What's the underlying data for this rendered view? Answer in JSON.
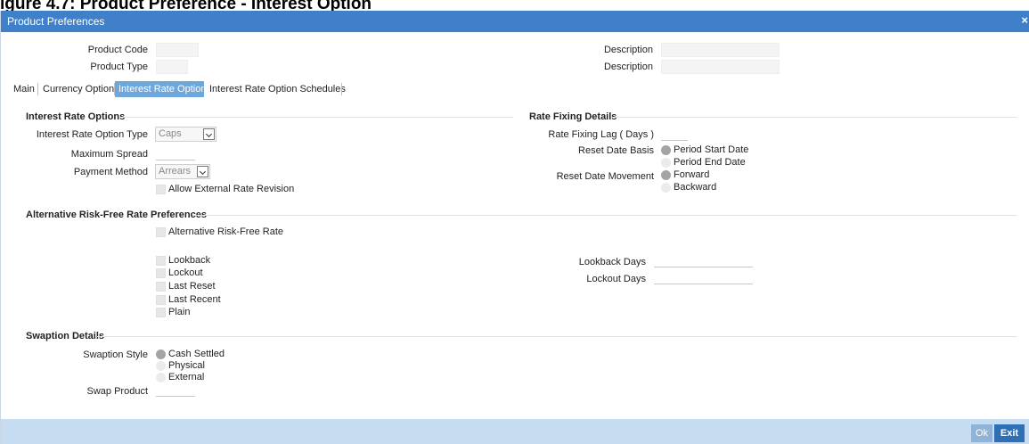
{
  "caption": "igure 4.7: Product Preference - Interest Option",
  "window": {
    "title": "Product Preferences",
    "close_glyph": "×"
  },
  "header": {
    "product_code_label": "Product Code",
    "product_type_label": "Product Type",
    "description_label_1": "Description",
    "description_label_2": "Description",
    "product_code_value": "",
    "product_type_value": "",
    "description_value_1": "",
    "description_value_2": ""
  },
  "tabs": [
    {
      "label": "Main"
    },
    {
      "label": "Currency Option"
    },
    {
      "label": "Interest Rate Option",
      "active": true
    },
    {
      "label": "Interest Rate Option Schedules"
    }
  ],
  "interest_rate_options": {
    "title": "Interest Rate Options",
    "option_type_label": "Interest Rate Option Type",
    "option_type_value": "Caps",
    "max_spread_label": "Maximum Spread",
    "payment_method_label": "Payment Method",
    "payment_method_value": "Arrears",
    "allow_external_label": "Allow External Rate Revision"
  },
  "rate_fixing": {
    "title": "Rate Fixing Details",
    "lag_label": "Rate Fixing Lag ( Days )",
    "reset_basis_label": "Reset Date Basis",
    "reset_basis_options": [
      "Period Start Date",
      "Period End Date"
    ],
    "reset_basis_selected": "Period Start Date",
    "reset_movement_label": "Reset Date Movement",
    "reset_movement_options": [
      "Forward",
      "Backward"
    ],
    "reset_movement_selected": "Forward"
  },
  "arfr": {
    "title": "Alternative Risk-Free Rate Preferences",
    "arfr_label": "Alternative Risk-Free Rate",
    "options": [
      "Lookback",
      "Lockout",
      "Last Reset",
      "Last Recent",
      "Plain"
    ],
    "lookback_days_label": "Lookback Days",
    "lockout_days_label": "Lockout Days"
  },
  "swaption": {
    "title": "Swaption Details",
    "style_label": "Swaption Style",
    "style_options": [
      "Cash Settled",
      "Physical",
      "External"
    ],
    "style_selected": "Cash Settled",
    "swap_product_label": "Swap Product"
  },
  "footer": {
    "ok_label": "Ok",
    "exit_label": "Exit"
  },
  "colors": {
    "titlebar": "#3f80c9",
    "tab_active": "#6ea7dc",
    "footer": "#c5dcf1",
    "exit_button": "#2f6fb5"
  }
}
